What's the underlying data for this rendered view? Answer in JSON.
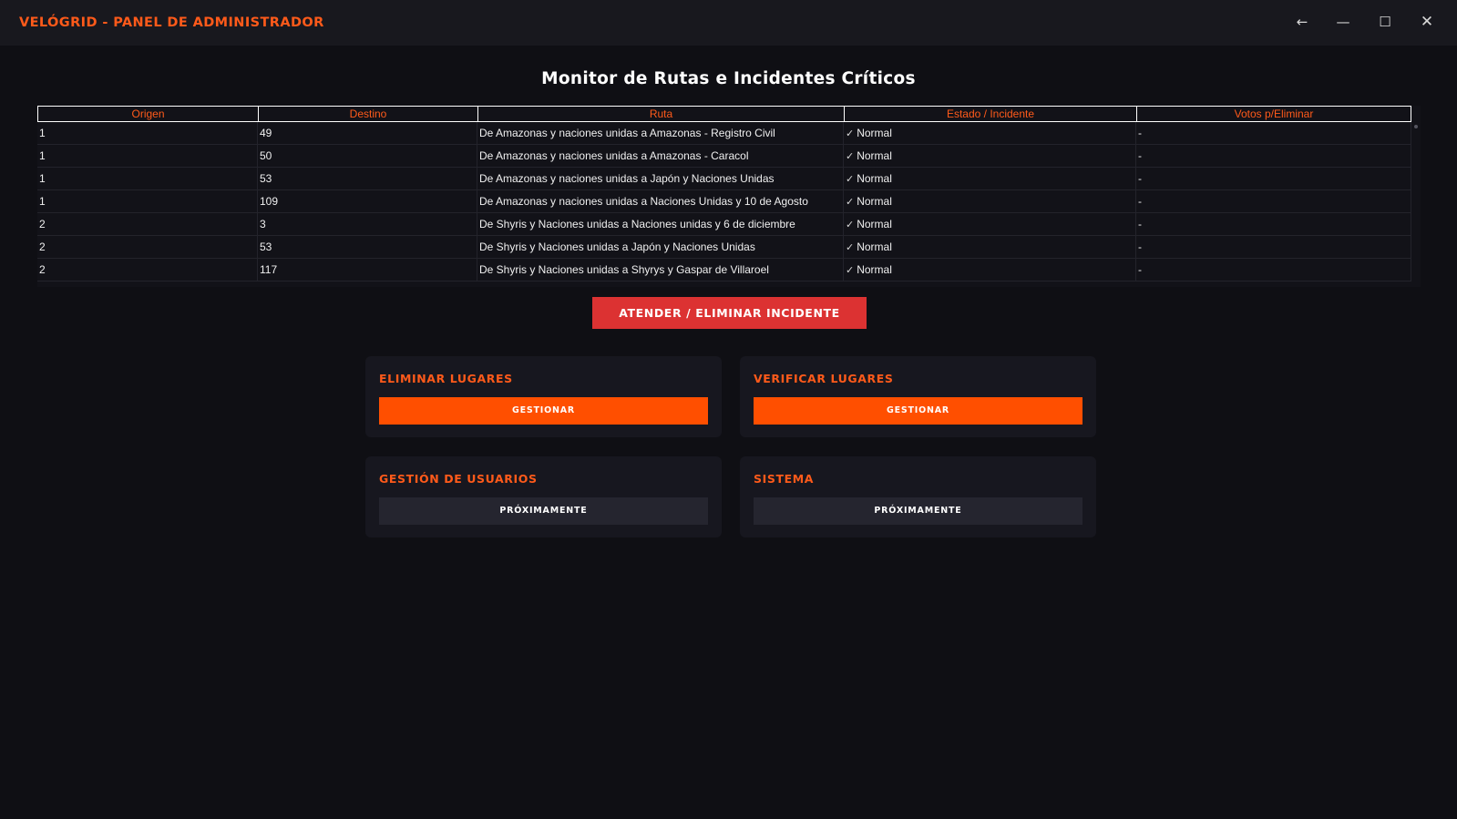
{
  "window": {
    "title": "VELÓGRID - PANEL DE ADMINISTRADOR",
    "controls": {
      "back": "←",
      "minimize": "—",
      "maximize": "☐",
      "close": "✕"
    }
  },
  "page": {
    "title": "Monitor de Rutas e Incidentes Críticos"
  },
  "table": {
    "columns": [
      "Origen",
      "Destino",
      "Ruta",
      "Estado / Incidente",
      "Votos p/Eliminar"
    ],
    "rows": [
      {
        "origen": "1",
        "destino": "49",
        "ruta": "De Amazonas y naciones unidas a Amazonas - Registro Civil",
        "estado_icon": "✓",
        "estado": "Normal",
        "votos": "-"
      },
      {
        "origen": "1",
        "destino": "50",
        "ruta": "De Amazonas y naciones unidas a Amazonas - Caracol",
        "estado_icon": "✓",
        "estado": "Normal",
        "votos": "-"
      },
      {
        "origen": "1",
        "destino": "53",
        "ruta": "De Amazonas y naciones unidas a Japón y Naciones Unidas",
        "estado_icon": "✓",
        "estado": "Normal",
        "votos": "-"
      },
      {
        "origen": "1",
        "destino": "109",
        "ruta": "De Amazonas y naciones unidas a Naciones Unidas y 10 de Agosto",
        "estado_icon": "✓",
        "estado": "Normal",
        "votos": "-"
      },
      {
        "origen": "2",
        "destino": "3",
        "ruta": "De Shyris y Naciones unidas a Naciones unidas y 6 de diciembre",
        "estado_icon": "✓",
        "estado": "Normal",
        "votos": "-"
      },
      {
        "origen": "2",
        "destino": "53",
        "ruta": "De Shyris y Naciones unidas a Japón y Naciones Unidas",
        "estado_icon": "✓",
        "estado": "Normal",
        "votos": "-"
      },
      {
        "origen": "2",
        "destino": "117",
        "ruta": "De Shyris y Naciones unidas a Shyrys y Gaspar de Villaroel",
        "estado_icon": "✓",
        "estado": "Normal",
        "votos": "-"
      }
    ]
  },
  "actions": {
    "attend_label": "ATENDER / ELIMINAR INCIDENTE"
  },
  "cards": [
    {
      "title": "ELIMINAR LUGARES",
      "button": "GESTIONAR",
      "style": "orange"
    },
    {
      "title": "VERIFICAR LUGARES",
      "button": "GESTIONAR",
      "style": "orange"
    },
    {
      "title": "GESTIÓN DE USUARIOS",
      "button": "PRÓXIMAMENTE",
      "style": "gray"
    },
    {
      "title": "SISTEMA",
      "button": "PRÓXIMAMENTE",
      "style": "gray"
    }
  ],
  "colors": {
    "accent": "#ff5a1a",
    "danger": "#dc3232",
    "background": "#0f0f14",
    "card": "#17171f"
  }
}
